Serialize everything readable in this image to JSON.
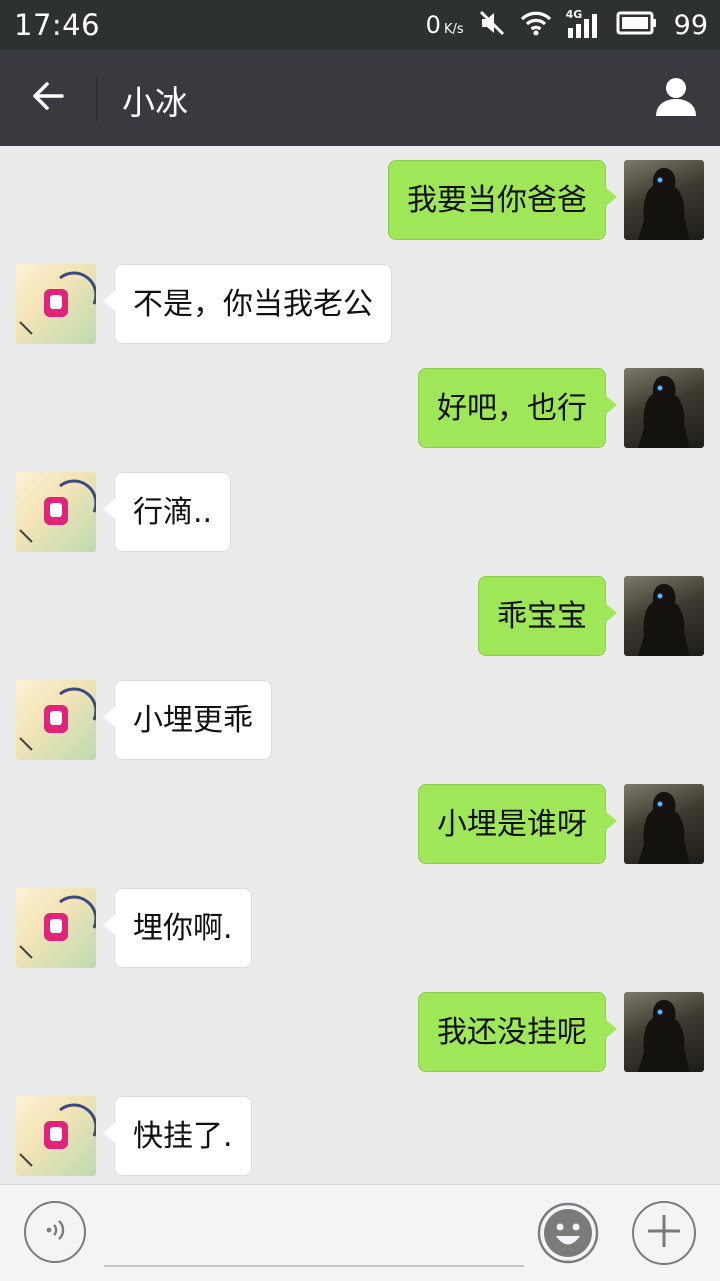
{
  "status_bar": {
    "time": "17:46",
    "net_speed": "0",
    "net_unit": "K/s",
    "network": "4G",
    "battery_level": "99",
    "icons": [
      "mute-icon",
      "wifi-icon",
      "signal-icon",
      "battery-icon"
    ]
  },
  "header": {
    "title": "小冰",
    "back_icon": "arrow-left-icon",
    "profile_icon": "person-icon"
  },
  "messages": [
    {
      "side": "right",
      "sender": "me",
      "text": "我要当你爸爸"
    },
    {
      "side": "left",
      "sender": "小冰",
      "text": "不是，你当我老公"
    },
    {
      "side": "right",
      "sender": "me",
      "text": "好吧，也行"
    },
    {
      "side": "left",
      "sender": "小冰",
      "text": "行滴.."
    },
    {
      "side": "right",
      "sender": "me",
      "text": "乖宝宝"
    },
    {
      "side": "left",
      "sender": "小冰",
      "text": "小埋更乖"
    },
    {
      "side": "right",
      "sender": "me",
      "text": "小埋是谁呀"
    },
    {
      "side": "left",
      "sender": "小冰",
      "text": "埋你啊."
    },
    {
      "side": "right",
      "sender": "me",
      "text": "我还没挂呢"
    },
    {
      "side": "left",
      "sender": "小冰",
      "text": "快挂了."
    }
  ],
  "input_bar": {
    "text_value": "",
    "voice_icon": "voice-icon",
    "emoji_icon": "smiley-icon",
    "plus_icon": "plus-icon"
  },
  "colors": {
    "status_bar": "#2e3132",
    "title_bar": "#393a3f",
    "chat_bg": "#ebebeb",
    "bubble_me": "#9fe658",
    "bubble_other": "#ffffff"
  }
}
